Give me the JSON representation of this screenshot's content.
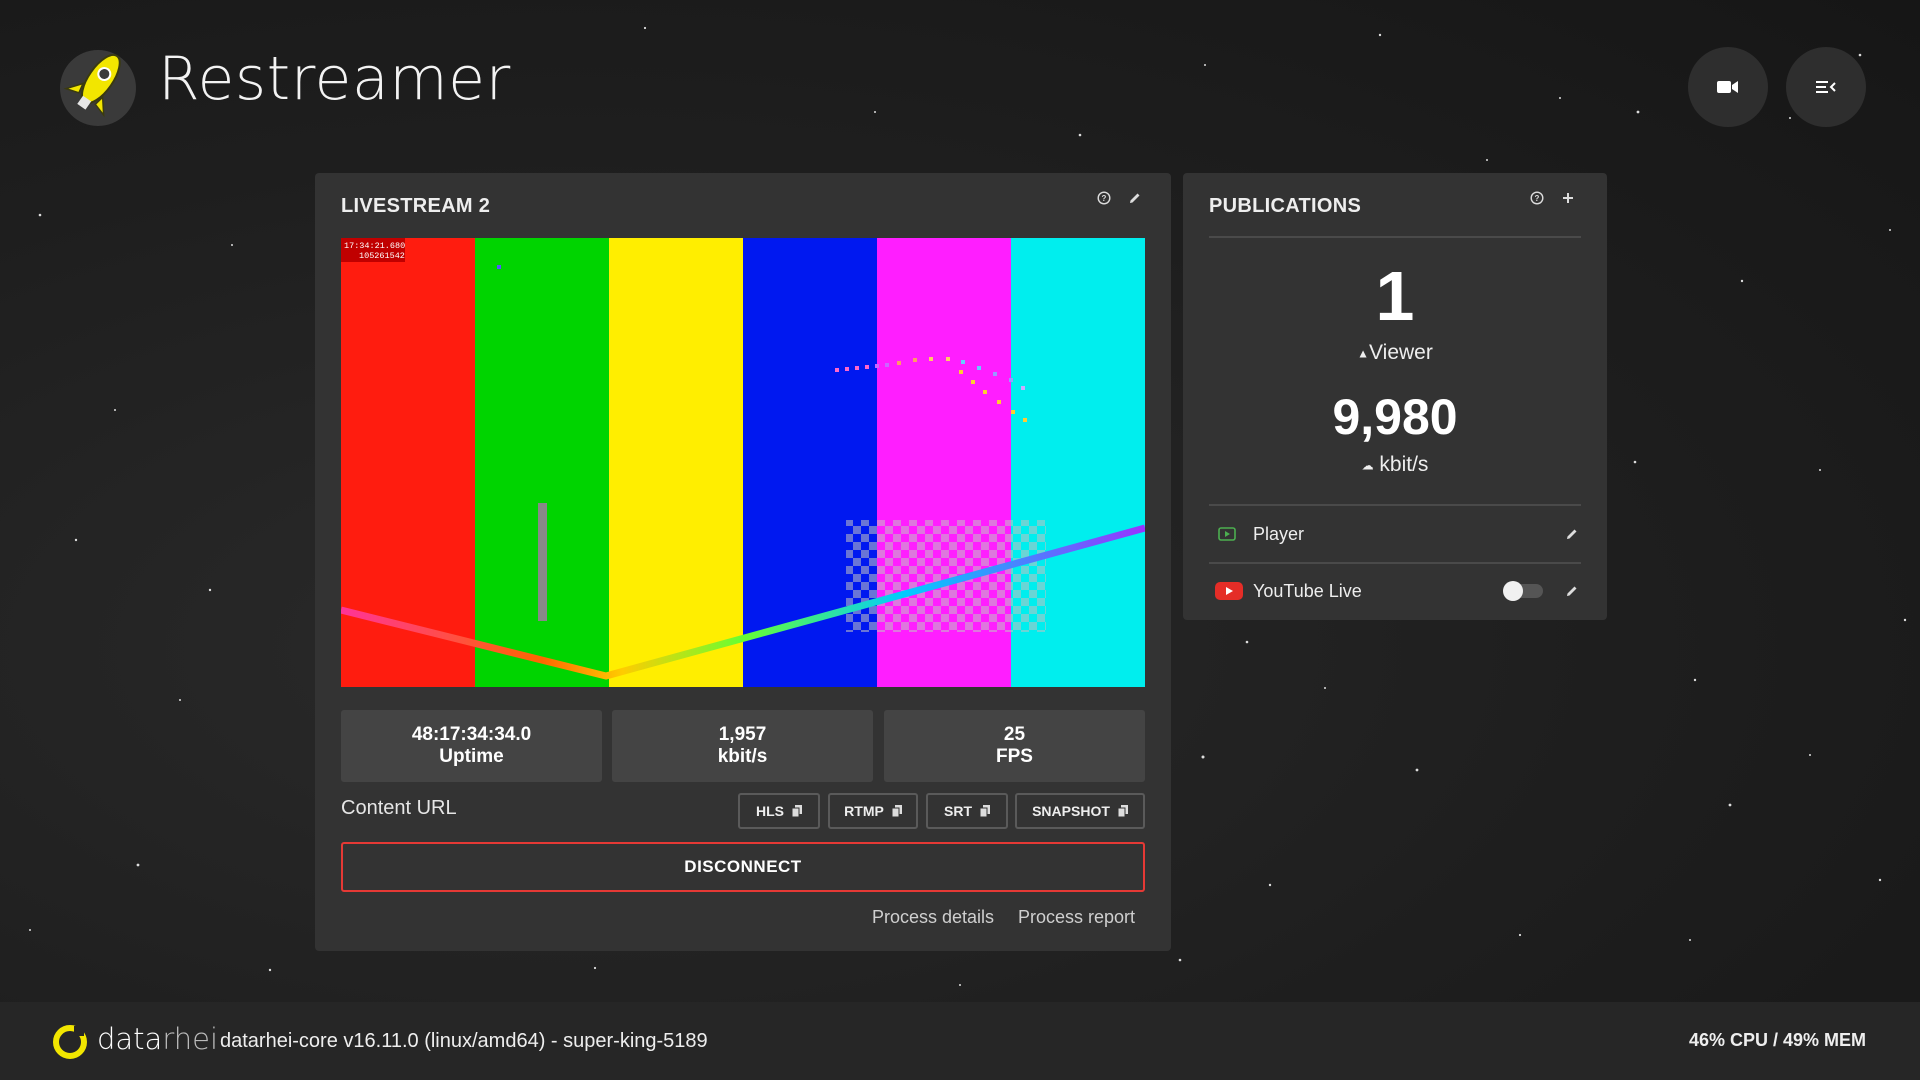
{
  "app": {
    "title": "Restreamer"
  },
  "header": {
    "camera_icon": "video-camera-icon",
    "menu_icon": "menu-open-icon"
  },
  "stream": {
    "title": "LIVESTREAM 2",
    "overlay_time": "17:34:21.680",
    "overlay_frame": "105261542",
    "bar_colors": [
      "#ff1c0f",
      "#00d400",
      "#ffee00",
      "#0018f0",
      "#ff1eff",
      "#00eeee"
    ],
    "stats": [
      {
        "value": "48:17:34:34.0",
        "label": "Uptime"
      },
      {
        "value": "1,957",
        "label": "kbit/s"
      },
      {
        "value": "25",
        "label": "FPS"
      }
    ],
    "content_url_label": "Content URL",
    "url_buttons": [
      "HLS",
      "RTMP",
      "SRT",
      "SNAPSHOT"
    ],
    "disconnect_label": "DISCONNECT",
    "links": {
      "process_details": "Process details",
      "process_report": "Process report"
    }
  },
  "publications": {
    "title": "PUBLICATIONS",
    "viewers_count": "1",
    "viewers_label": "Viewer",
    "bitrate_value": "9,980",
    "bitrate_unit": "kbit/s",
    "items": [
      {
        "name": "Player",
        "icon": "player-icon",
        "accent": "#4caf50"
      },
      {
        "name": "YouTube Live",
        "icon": "youtube-icon",
        "accent": "#e52d27",
        "toggle_on": false
      }
    ]
  },
  "footer": {
    "brand_a": "data",
    "brand_b": "rhei",
    "core_version": "datarhei-core v16.11.0 (linux/amd64) - super-king-5189",
    "system_stats": "46% CPU / 49% MEM"
  },
  "colors": {
    "panel": "#333333",
    "accent_red": "#e53935",
    "logo_yellow": "#f2e600"
  }
}
